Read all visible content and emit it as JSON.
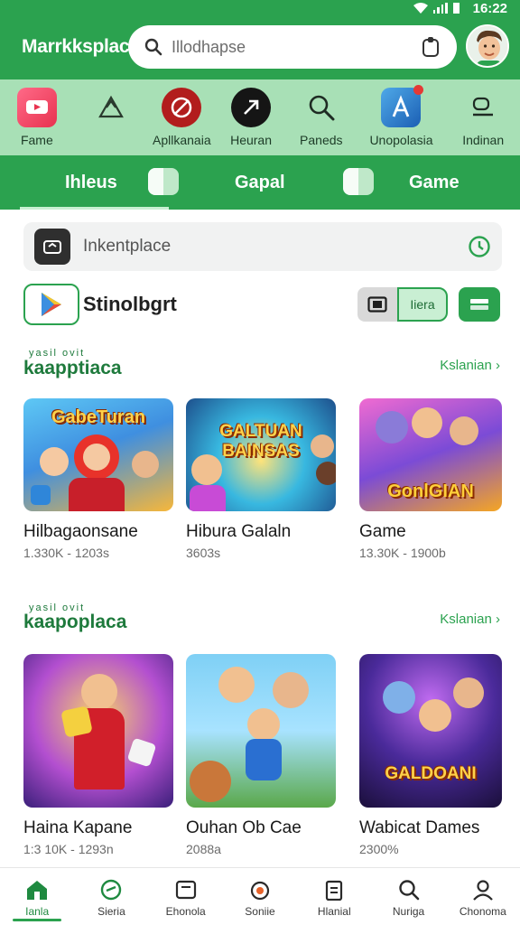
{
  "status_bar": {
    "time": "16:22"
  },
  "header": {
    "title": "Marrkksplace",
    "search_placeholder": "Illodhapse"
  },
  "categories": [
    {
      "label": "Fame",
      "icon": "tv-icon"
    },
    {
      "label": "",
      "icon": "recycle-icon"
    },
    {
      "label": "Apllkanaia",
      "icon": "compass-icon"
    },
    {
      "label": "Heuran",
      "icon": "arrow-circle-icon"
    },
    {
      "label": "Paneds",
      "icon": "search-icon"
    },
    {
      "label": "Unopolasia",
      "icon": "app-store-icon"
    },
    {
      "label": "Indinan",
      "icon": "messages-icon"
    }
  ],
  "tabs": [
    {
      "label": "Ihleus",
      "active": true
    },
    {
      "label": "Gapal",
      "active": false
    },
    {
      "label": "Game",
      "active": false
    }
  ],
  "marketplace_search": {
    "placeholder": "Inkentplace"
  },
  "store": {
    "name": "Stinolbgrt",
    "chip_label": "Iiera"
  },
  "sections": [
    {
      "super": "yasil ovit",
      "title": "kaapptiaca",
      "see_all": "Kslanian",
      "cards": [
        {
          "thumb_title": "GabeTuran",
          "name": "Hilbagaonsane",
          "meta": "1.330K - 1203s"
        },
        {
          "thumb_title": "GALTUAN BAINSAS",
          "name": "Hibura Galaln",
          "meta": "3603s"
        },
        {
          "thumb_title": "GonlGIAN",
          "name": "Game",
          "meta": "13.30K - 1900b"
        }
      ]
    },
    {
      "super": "yasil ovit",
      "title": "kaapoplaca",
      "see_all": "Kslanian",
      "cards": [
        {
          "thumb_title": "",
          "name": "Haina Kapane",
          "meta": "1:3 10K - 1293n"
        },
        {
          "thumb_title": "",
          "name": "Ouhan Ob Cae",
          "meta": "2088a"
        },
        {
          "thumb_title": "GALDOANI",
          "name": "Wabicat Dames",
          "meta": "2300%"
        }
      ]
    }
  ],
  "bottom_nav": [
    {
      "label": "Ianla",
      "icon": "home-icon",
      "active": true
    },
    {
      "label": "Sieria",
      "icon": "chat-icon",
      "active": false
    },
    {
      "label": "Ehonola",
      "icon": "book-icon",
      "active": false
    },
    {
      "label": "Soniie",
      "icon": "shop-icon",
      "active": false
    },
    {
      "label": "Hlanial",
      "icon": "clipboard-icon",
      "active": false
    },
    {
      "label": "Nuriga",
      "icon": "search-icon",
      "active": false
    },
    {
      "label": "Chonoma",
      "icon": "profile-icon",
      "active": false
    }
  ],
  "colors": {
    "brand": "#2ba24f",
    "strip": "#a8e0b6",
    "section": "#1e7a3c"
  }
}
